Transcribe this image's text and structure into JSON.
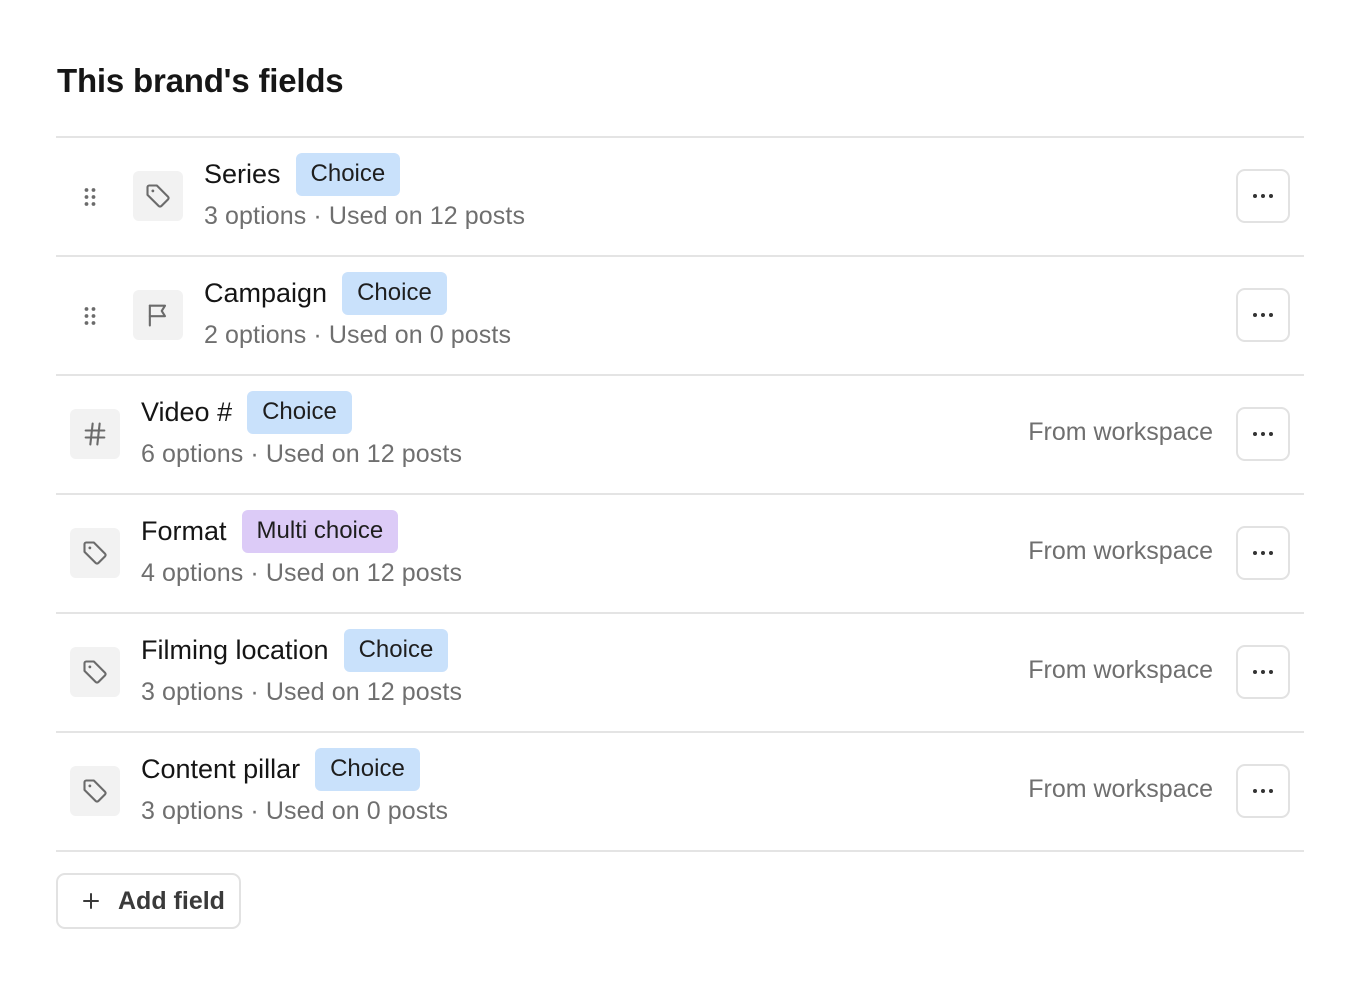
{
  "page": {
    "title": "This brand's fields"
  },
  "fields": [
    {
      "name": "Series",
      "type": "Choice",
      "type_style": "choice",
      "meta": "3 options · Used on 12 posts",
      "icon": "tag-icon",
      "draggable": true,
      "source": ""
    },
    {
      "name": "Campaign",
      "type": "Choice",
      "type_style": "choice",
      "meta": "2 options · Used on 0 posts",
      "icon": "flag-icon",
      "draggable": true,
      "source": ""
    },
    {
      "name": "Video #",
      "type": "Choice",
      "type_style": "choice",
      "meta": "6 options · Used on 12 posts",
      "icon": "hash-icon",
      "draggable": false,
      "source": "From workspace"
    },
    {
      "name": "Format",
      "type": "Multi choice",
      "type_style": "multi",
      "meta": "4 options · Used on 12 posts",
      "icon": "tag-icon",
      "draggable": false,
      "source": "From workspace"
    },
    {
      "name": "Filming location",
      "type": "Choice",
      "type_style": "choice",
      "meta": "3 options · Used on 12 posts",
      "icon": "tag-icon",
      "draggable": false,
      "source": "From workspace"
    },
    {
      "name": "Content pillar",
      "type": "Choice",
      "type_style": "choice",
      "meta": "3 options · Used on 0 posts",
      "icon": "tag-icon",
      "draggable": false,
      "source": "From workspace"
    }
  ],
  "actions": {
    "add_field_label": "Add field"
  },
  "colors": {
    "choice_badge": "#c9e1fb",
    "multi_badge": "#dccbf7",
    "divider": "#e4e4e4",
    "muted_text": "#6f6f6f"
  }
}
